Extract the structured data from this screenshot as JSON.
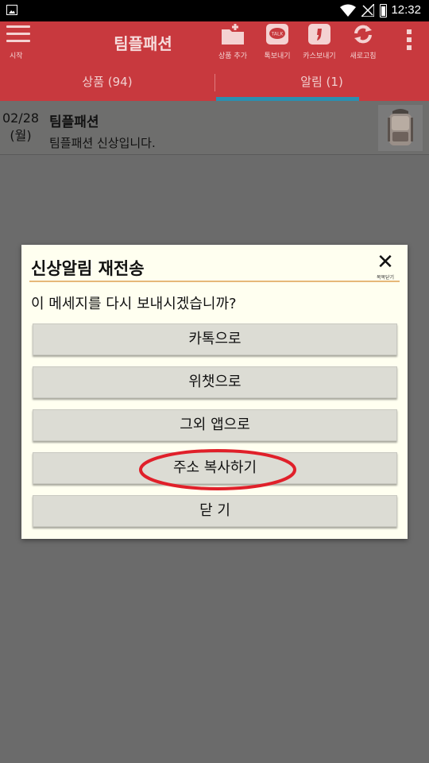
{
  "status_bar": {
    "time": "12:32"
  },
  "app_bar": {
    "menu_label": "시작",
    "title": "팀플패션",
    "tools": [
      {
        "icon": "folder-add-icon",
        "label": "상품 추가"
      },
      {
        "icon": "kakaotalk-icon",
        "label": "톡보내기"
      },
      {
        "icon": "kakaostory-icon",
        "label": "카스보내기"
      },
      {
        "icon": "refresh-icon",
        "label": "새로고침"
      }
    ],
    "talk_badge": "TALK"
  },
  "tabs": [
    {
      "label": "상품 (94)",
      "selected": false
    },
    {
      "label": "알림 (1)",
      "selected": true
    }
  ],
  "notifications": [
    {
      "date": "02/28",
      "weekday": "(월)",
      "title": "팀플패션",
      "message": "팀플패션 신상입니다."
    }
  ],
  "dialog": {
    "title": "신상알림 재전송",
    "close_label": "복목닫기",
    "message": "이 메세지를 다시 보내시겠습니까?",
    "buttons": [
      "카톡으로",
      "위챗으로",
      "그외 앱으로",
      "주소 복사하기",
      "닫 기"
    ],
    "highlight_color": "#e0202a"
  },
  "colors": {
    "accent": "#c8393e",
    "indicator": "#2a8fb0"
  }
}
